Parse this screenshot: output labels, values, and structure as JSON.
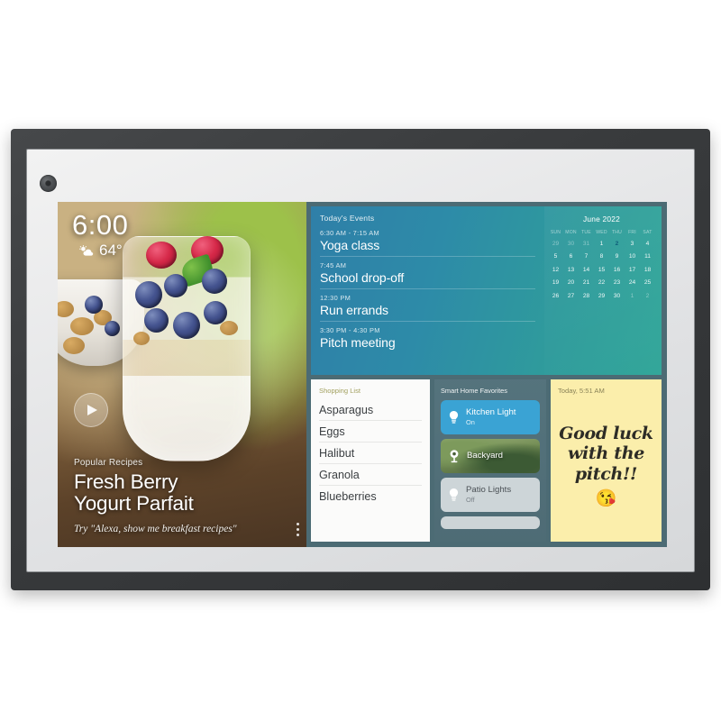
{
  "device": {
    "name": "smart-display",
    "camera_icon": "camera-lens-icon"
  },
  "recipe_card": {
    "clock": {
      "time": "6:00",
      "temperature": "64°",
      "weather_icon": "sun-behind-cloud-icon"
    },
    "play_icon": "play-icon",
    "kicker": "Popular Recipes",
    "title_line1": "Fresh Berry",
    "title_line2": "Yogurt Parfait",
    "hint": "Try \"Alexa, show me breakfast recipes\"",
    "menu_icon": "kebab-menu-icon"
  },
  "events_panel": {
    "heading": "Today's Events",
    "items": [
      {
        "time": "6:30 AM - 7:15 AM",
        "title": "Yoga class"
      },
      {
        "time": "7:45 AM",
        "title": "School drop-off"
      },
      {
        "time": "12:30 PM",
        "title": "Run errands"
      },
      {
        "time": "3:30 PM - 4:30 PM",
        "title": "Pitch meeting"
      }
    ]
  },
  "calendar": {
    "title": "June 2022",
    "day_headers": [
      "SUN",
      "MON",
      "TUE",
      "WED",
      "THU",
      "FRI",
      "SAT"
    ],
    "today": 2,
    "weeks": [
      [
        {
          "d": "29",
          "muted": true
        },
        {
          "d": "30",
          "muted": true
        },
        {
          "d": "31",
          "muted": true
        },
        {
          "d": "1"
        },
        {
          "d": "2",
          "today": true
        },
        {
          "d": "3"
        },
        {
          "d": "4"
        }
      ],
      [
        {
          "d": "5"
        },
        {
          "d": "6"
        },
        {
          "d": "7"
        },
        {
          "d": "8"
        },
        {
          "d": "9"
        },
        {
          "d": "10"
        },
        {
          "d": "11"
        }
      ],
      [
        {
          "d": "12"
        },
        {
          "d": "13"
        },
        {
          "d": "14"
        },
        {
          "d": "15"
        },
        {
          "d": "16"
        },
        {
          "d": "17"
        },
        {
          "d": "18"
        }
      ],
      [
        {
          "d": "19"
        },
        {
          "d": "20"
        },
        {
          "d": "21"
        },
        {
          "d": "22"
        },
        {
          "d": "23"
        },
        {
          "d": "24"
        },
        {
          "d": "25"
        }
      ],
      [
        {
          "d": "26"
        },
        {
          "d": "27"
        },
        {
          "d": "28"
        },
        {
          "d": "29"
        },
        {
          "d": "30"
        },
        {
          "d": "1",
          "muted": true
        },
        {
          "d": "2",
          "muted": true
        }
      ]
    ]
  },
  "shopping_list": {
    "heading": "Shopping List",
    "items": [
      "Asparagus",
      "Eggs",
      "Halibut",
      "Granola",
      "Blueberries"
    ]
  },
  "smart_home": {
    "heading": "Smart Home Favorites",
    "tiles": [
      {
        "label": "Kitchen Light",
        "state": "On",
        "icon": "lightbulb-icon",
        "style": "on"
      },
      {
        "label": "Backyard",
        "state": "",
        "icon": "camera-icon",
        "style": "cam"
      },
      {
        "label": "Patio Lights",
        "state": "Off",
        "icon": "lightbulb-icon",
        "style": "off"
      }
    ]
  },
  "sticky_note": {
    "timestamp": "Today, 5:51 AM",
    "line1": "Good luck",
    "line2": "with the",
    "line3": "pitch!!",
    "emoji": "😘"
  },
  "colors": {
    "accent_blue": "#3aa3d4",
    "events_gradient_start": "#2f7fa8",
    "events_gradient_end": "#33a79a",
    "note_yellow": "#fbeeab",
    "bezel": "#393b3d"
  }
}
